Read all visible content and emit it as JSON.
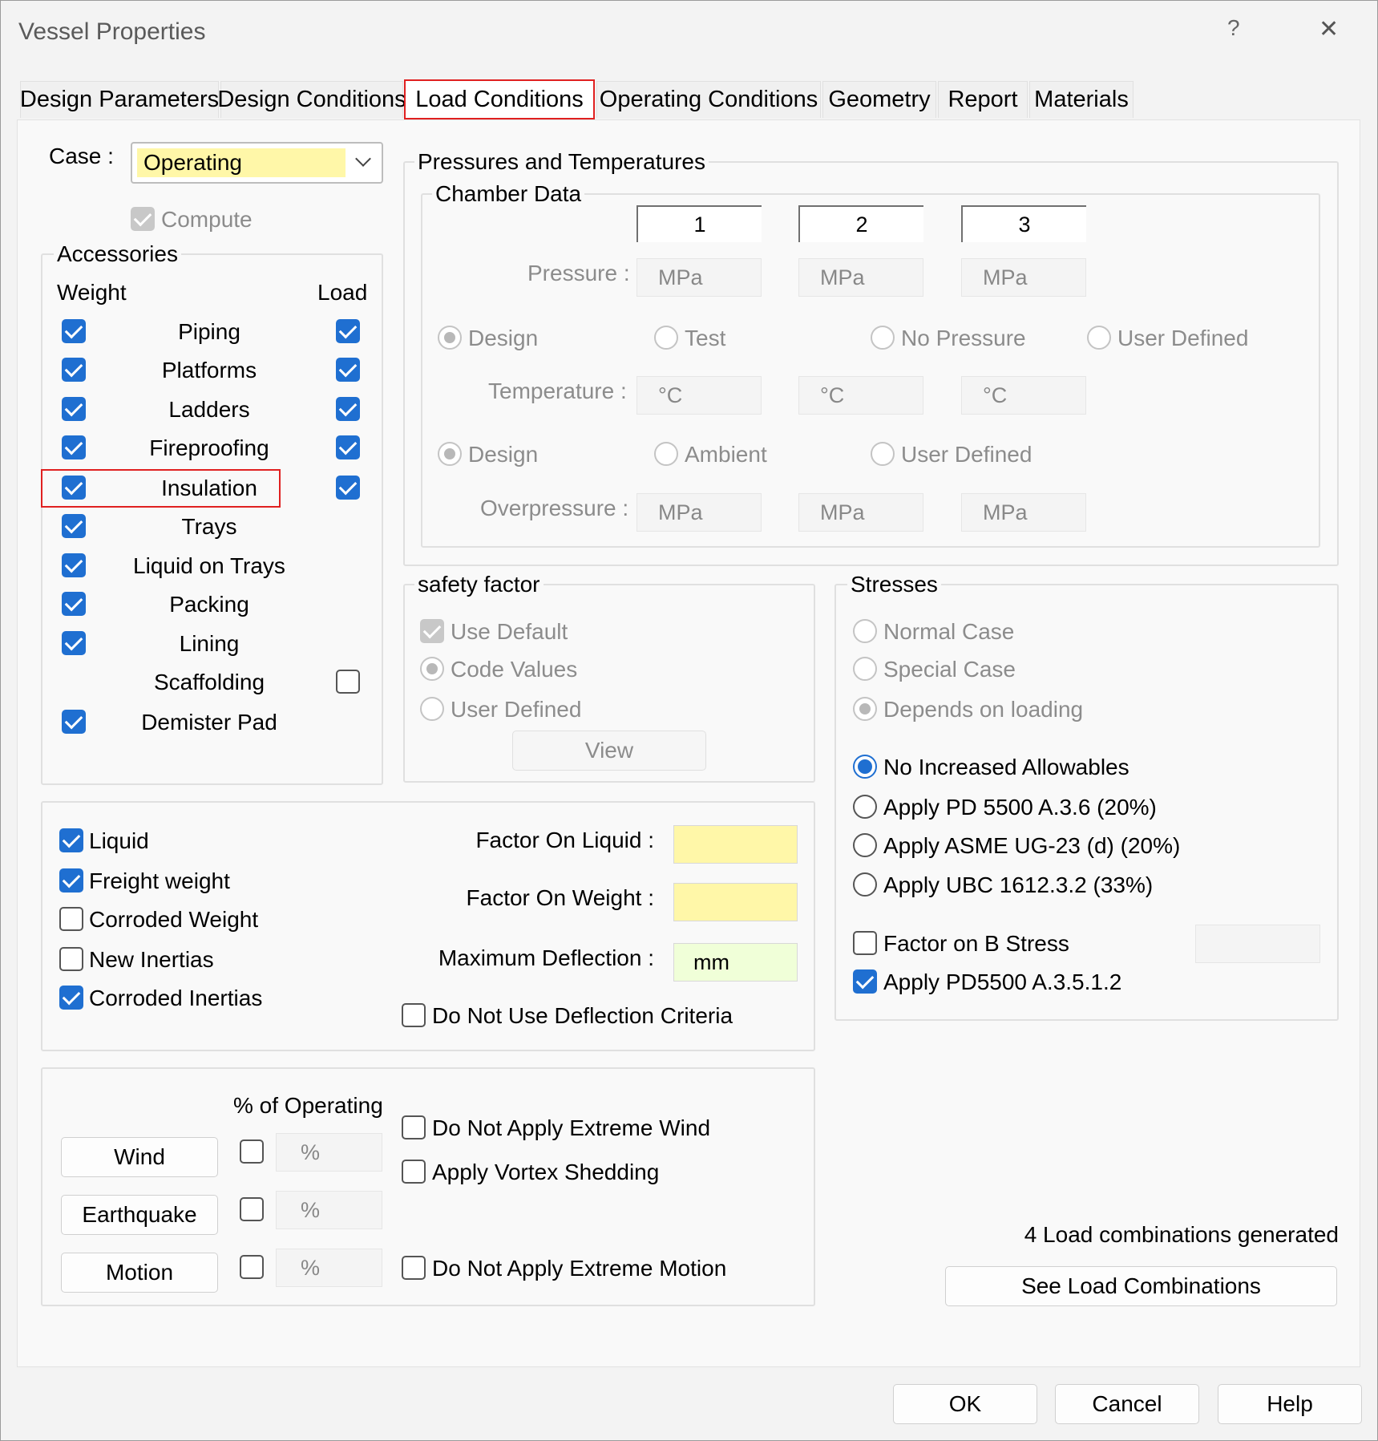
{
  "window": {
    "title": "Vessel Properties",
    "help_glyph": "?",
    "close_glyph": "✕"
  },
  "tabs": [
    "Design Parameters",
    "Design Conditions",
    "Load Conditions",
    "Operating Conditions",
    "Geometry",
    "Report",
    "Materials"
  ],
  "active_tab": "Load Conditions",
  "case": {
    "label": "Case :",
    "value": "Operating"
  },
  "compute": {
    "label": "Compute",
    "checked": true,
    "disabled": true
  },
  "accessories": {
    "title": "Accessories",
    "weight_header": "Weight",
    "load_header": "Load",
    "items": [
      {
        "label": "Piping",
        "weight": true,
        "load": true
      },
      {
        "label": "Platforms",
        "weight": true,
        "load": true
      },
      {
        "label": "Ladders",
        "weight": true,
        "load": true
      },
      {
        "label": "Fireproofing",
        "weight": true,
        "load": true
      },
      {
        "label": "Insulation",
        "weight": true,
        "load": true
      },
      {
        "label": "Trays",
        "weight": true,
        "load": null
      },
      {
        "label": "Liquid on Trays",
        "weight": true,
        "load": null
      },
      {
        "label": "Packing",
        "weight": true,
        "load": null
      },
      {
        "label": "Lining",
        "weight": true,
        "load": null
      },
      {
        "label": "Scaffolding",
        "weight": null,
        "load": false
      },
      {
        "label": "Demister Pad",
        "weight": true,
        "load": null
      }
    ]
  },
  "pressures": {
    "title": "Pressures and Temperatures",
    "chamber_title": "Chamber Data",
    "chambers": [
      "1",
      "2",
      "3"
    ],
    "pressure_label": "Pressure :",
    "pressure_unit": "MPa",
    "pressure_options": [
      "Design",
      "Test",
      "No Pressure",
      "User Defined"
    ],
    "temperature_label": "Temperature :",
    "temperature_unit": "°C",
    "temperature_options": [
      "Design",
      "Ambient",
      "User Defined"
    ],
    "overpressure_label": "Overpressure :",
    "overpressure_unit": "MPa"
  },
  "safety": {
    "title": "safety factor",
    "use_default": "Use Default",
    "code_values": "Code Values",
    "user_defined": "User Defined",
    "view_button": "View"
  },
  "stresses": {
    "title": "Stresses",
    "normal_case": "Normal Case",
    "special_case": "Special Case",
    "depends": "Depends on loading",
    "no_increased": "No Increased Allowables",
    "pd5500": "Apply PD 5500 A.3.6 (20%)",
    "asme": "Apply ASME UG-23 (d) (20%)",
    "ubc": "Apply UBC 1612.3.2 (33%)",
    "factor_b": "Factor on B Stress",
    "apply_pd": "Apply PD5500 A.3.5.1.2"
  },
  "weights": {
    "liquid": "Liquid",
    "freight": "Freight weight",
    "corroded_weight": "Corroded Weight",
    "new_inertias": "New Inertias",
    "corroded_inertias": "Corroded Inertias",
    "factor_liquid": "Factor On Liquid :",
    "factor_weight": "Factor On Weight :",
    "max_deflection": "Maximum Deflection :",
    "deflection_unit": "mm",
    "no_deflection": "Do Not Use Deflection Criteria"
  },
  "loads": {
    "pct_header": "% of Operating",
    "wind": "Wind",
    "earthquake": "Earthquake",
    "motion": "Motion",
    "pct_unit": "%",
    "no_extreme_wind": "Do Not Apply Extreme Wind",
    "vortex": "Apply Vortex Shedding",
    "no_extreme_motion": "Do Not Apply Extreme Motion"
  },
  "combinations": {
    "summary": "4 Load combinations generated",
    "button": "See Load Combinations"
  },
  "footer": {
    "ok": "OK",
    "cancel": "Cancel",
    "help": "Help"
  },
  "colors": {
    "accent": "#1f6fd1",
    "highlight_red": "#e02020",
    "field_yellow": "#fff7a8",
    "field_green": "#f0ffd8"
  }
}
